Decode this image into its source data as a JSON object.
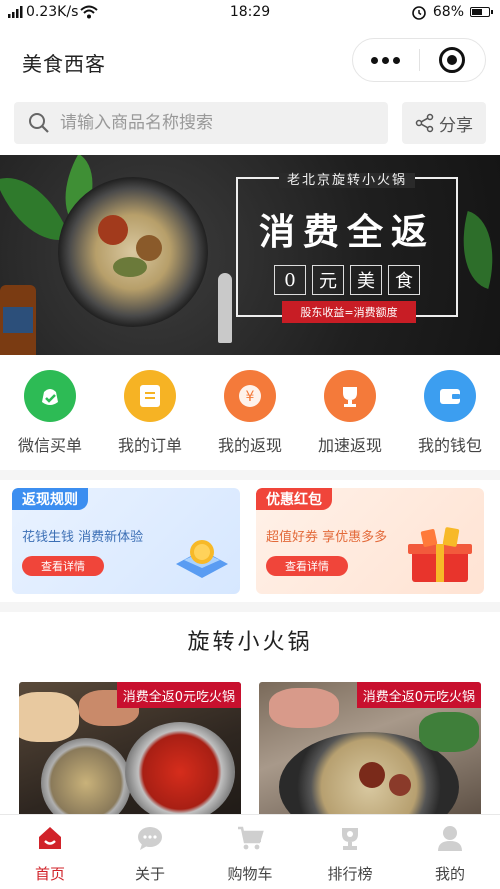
{
  "status_bar": {
    "network_speed": "0.23K/s",
    "time": "18:29",
    "battery": "68%",
    "battery_level": 0.68
  },
  "header": {
    "title": "美食西客",
    "more_icon": "more-dots-icon",
    "close_icon": "target-icon"
  },
  "search": {
    "placeholder": "请输入商品名称搜索",
    "share_label": "分享"
  },
  "banner": {
    "small_title": "老北京旋转小火锅",
    "headline": "消费全返",
    "sub_chars": [
      "0",
      "元",
      "美",
      "食"
    ],
    "tag": "股东收益=消费额度"
  },
  "quick_menu": [
    {
      "label": "微信买单",
      "icon": "wechat-pay-icon",
      "color": "#2dbb55"
    },
    {
      "label": "我的订单",
      "icon": "order-icon",
      "color": "#f6b324"
    },
    {
      "label": "我的返现",
      "icon": "yen-icon",
      "color": "#f47a3a"
    },
    {
      "label": "加速返现",
      "icon": "trophy-icon",
      "color": "#f47a3a"
    },
    {
      "label": "我的钱包",
      "icon": "wallet-icon",
      "color": "#3c9ef0"
    }
  ],
  "promos": [
    {
      "tag": "返现规则",
      "desc": "花钱生钱  消费新体验",
      "button": "查看详情"
    },
    {
      "tag": "优惠红包",
      "desc": "超值好券  享优惠多多",
      "button": "查看详情"
    }
  ],
  "section": {
    "title": "旋转小火锅"
  },
  "products": [
    {
      "tag": "消费全返0元吃火锅"
    },
    {
      "tag": "消费全返0元吃火锅"
    }
  ],
  "tabbar": [
    {
      "label": "首页",
      "icon": "home-icon",
      "active": true
    },
    {
      "label": "关于",
      "icon": "chat-icon",
      "active": false
    },
    {
      "label": "购物车",
      "icon": "cart-icon",
      "active": false
    },
    {
      "label": "排行榜",
      "icon": "ranking-icon",
      "active": false
    },
    {
      "label": "我的",
      "icon": "user-icon",
      "active": false
    }
  ],
  "colors": {
    "accent": "#d1232a",
    "promo_blue": "#3c8ef0",
    "promo_red": "#f0453a"
  }
}
